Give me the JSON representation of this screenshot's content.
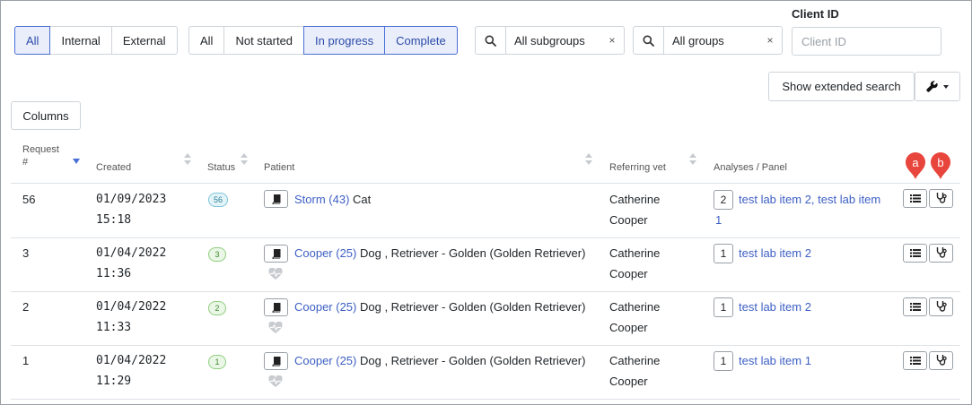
{
  "filters": {
    "source": [
      "All",
      "Internal",
      "External"
    ],
    "status": [
      "All",
      "Not started",
      "In progress",
      "Complete"
    ],
    "subgroups": {
      "value": "All subgroups",
      "clear": "×"
    },
    "groups": {
      "value": "All groups",
      "clear": "×"
    },
    "client_id": {
      "label": "Client ID",
      "placeholder": "Client ID",
      "value": ""
    }
  },
  "actions": {
    "extended_search": "Show extended search",
    "columns": "Columns",
    "tools_icon": "wrench-icon"
  },
  "table": {
    "headers": {
      "request_line1": "Request",
      "request_line2": "#",
      "created": "Created",
      "status": "Status",
      "patient": "Patient",
      "referring_vet": "Referring vet",
      "analyses": "Analyses / Panel"
    },
    "markers": {
      "a": "a",
      "b": "b",
      "color": "#e8453c"
    },
    "rows": [
      {
        "request": "56",
        "date": "01/09/2023",
        "time": "15:18",
        "status_badge": "56",
        "patient_link": "Storm (43)",
        "patient_desc": "Cat",
        "vet_first": "Catherine",
        "vet_last": "Cooper",
        "analyses_count": "2",
        "analyses_line1": "test lab item 2, test lab item",
        "analyses_line2": "1"
      },
      {
        "request": "3",
        "date": "01/04/2022",
        "time": "11:36",
        "status_badge": "3",
        "patient_link": "Cooper (25)",
        "patient_desc": "Dog , Retriever - Golden (Golden Retriever)",
        "vet_first": "Catherine",
        "vet_last": "Cooper",
        "analyses_count": "1",
        "analyses_line1": "test lab item 2"
      },
      {
        "request": "2",
        "date": "01/04/2022",
        "time": "11:33",
        "status_badge": "2",
        "patient_link": "Cooper (25)",
        "patient_desc": "Dog , Retriever - Golden (Golden Retriever)",
        "vet_first": "Catherine",
        "vet_last": "Cooper",
        "analyses_count": "1",
        "analyses_line1": "test lab item 2"
      },
      {
        "request": "1",
        "date": "01/04/2022",
        "time": "11:29",
        "status_badge": "1",
        "patient_link": "Cooper (25)",
        "patient_desc": "Dog , Retriever - Golden (Golden Retriever)",
        "vet_first": "Catherine",
        "vet_last": "Cooper",
        "analyses_count": "1",
        "analyses_line1": "test lab item 1"
      }
    ]
  },
  "colors": {
    "accent": "#4a6fd6",
    "link": "#3d5fc4",
    "marker": "#e8453c"
  }
}
